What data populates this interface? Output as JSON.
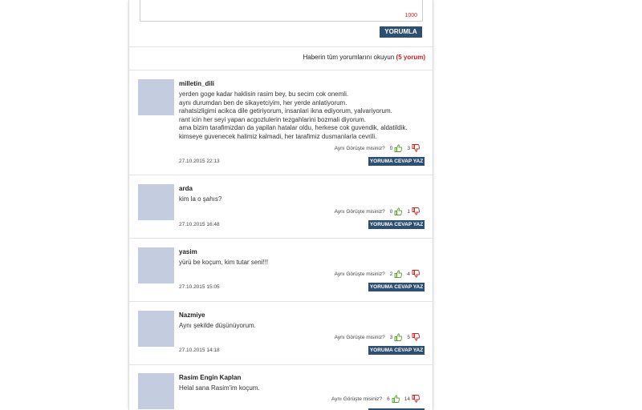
{
  "comment_form": {
    "char_counter": "1000",
    "submit_label": "YORUMLA"
  },
  "all_comments": {
    "link_text": "Haberin tüm yorumlarını okuyun",
    "count_text": "(5 yorum)"
  },
  "vote_question": "Aynı Görüşte misiniz?",
  "reply_label": "YORUMA CEVAP YAZ",
  "colors": {
    "button_bg": "#2d4f72",
    "counter": "#d21e1e",
    "like": "#5aa02c",
    "dislike": "#d21e1e"
  },
  "comments": [
    {
      "user": "milletin_dili",
      "lines": [
        "yerden goge kadar haklisin rasim bey, bu secim cok onemli.",
        "aynı durumdan ben de sikayetciyim, her yerde anlatiyorum.",
        "rahatsizligimi acikca dile getiriyorum, insanlari ikna ediyorum, yalvariyorum.",
        "rant icin her seyi yapan acgozlulerin tezgahlarini bozmali diyorum.",
        "ama bizim tarafimizdan da yapilan hatalar oldu, herkese cok guvendik, aldatildik.",
        "kimseye guvenecek halimiz kalmadi, her tarafimiz dusmanlarla cevrili."
      ],
      "likes": "0",
      "dislikes": "3",
      "date": "27.10.2015 22:13"
    },
    {
      "user": "arda",
      "lines": [
        "kim la o şahıs?"
      ],
      "likes": "0",
      "dislikes": "1",
      "date": "27.10.2015 16:48"
    },
    {
      "user": "yasim",
      "lines": [
        "yürü be koçum, kim tutar seni!!!"
      ],
      "likes": "2",
      "dislikes": "4",
      "date": "27.10.2015 15:05"
    },
    {
      "user": "Nazmiye",
      "lines": [
        "Aynı şekilde düşünüyorum."
      ],
      "likes": "3",
      "dislikes": "5",
      "date": "27.10.2015 14:18"
    },
    {
      "user": "Rasim Engin Kaplan",
      "lines": [
        "Helal sana Rasim'im koçum."
      ],
      "likes": "6",
      "dislikes": "14",
      "date": ""
    }
  ]
}
